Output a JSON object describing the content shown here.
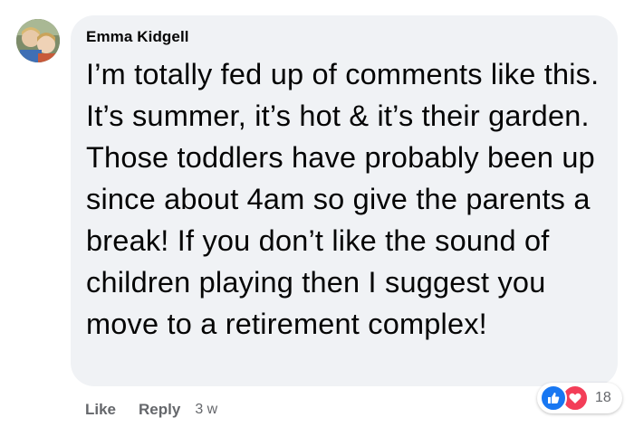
{
  "comment": {
    "author": "Emma Kidgell",
    "text": "I’m totally fed up of comments like this. It’s summer, it’s hot & it’s their garden. Those toddlers have probably been up since about 4am so give the parents a break! If you don’t like the sound of children playing then I suggest you move to a retirement complex!",
    "actions": {
      "like_label": "Like",
      "reply_label": "Reply",
      "timestamp": "3 w"
    },
    "reactions": {
      "icons": [
        "like-icon",
        "love-icon"
      ],
      "count": "18"
    }
  },
  "colors": {
    "bubble_background": "#f0f2f5",
    "text_primary": "#050505",
    "text_secondary": "#65676b",
    "like_blue": "#1877f2",
    "love_red": "#f33e58"
  }
}
